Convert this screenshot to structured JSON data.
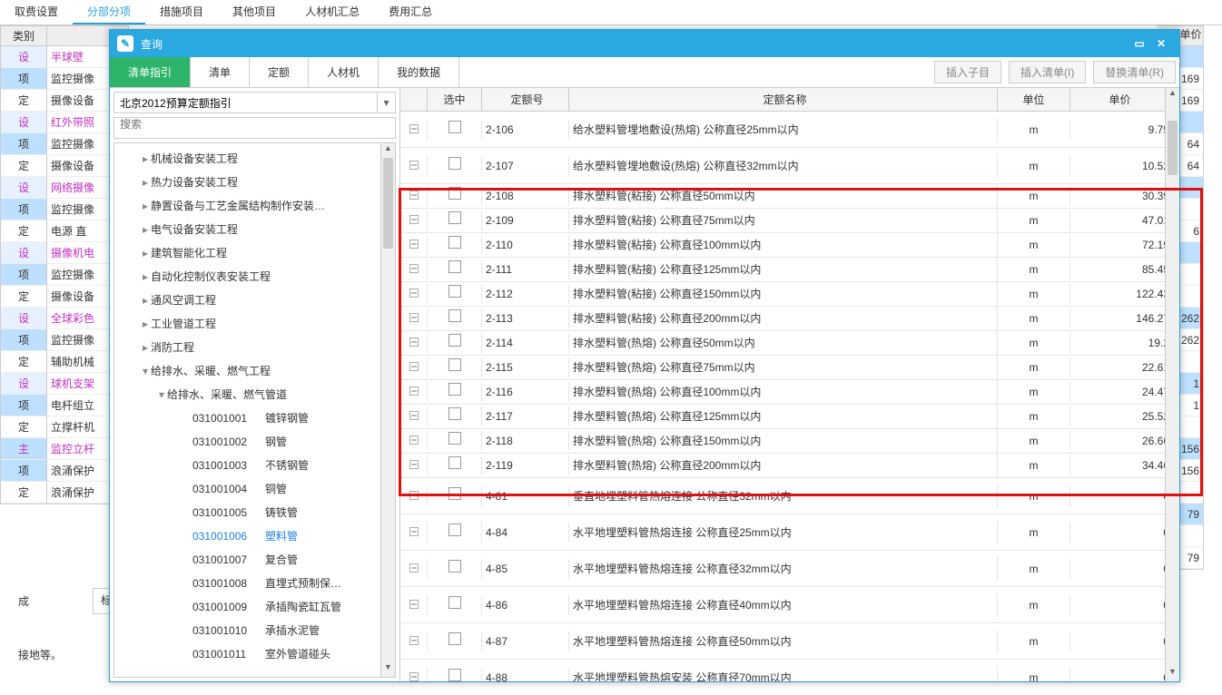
{
  "outer_tabs": [
    "取费设置",
    "分部分项",
    "措施项目",
    "其他项目",
    "人材机汇总",
    "费用汇总"
  ],
  "outer_active_index": 1,
  "left": {
    "cat_head": "类别",
    "rows": [
      {
        "k": "设",
        "name": "半球壁",
        "link": true
      },
      {
        "k": "项",
        "name": "监控摄像"
      },
      {
        "k": "定",
        "name": "摄像设备"
      },
      {
        "k": "设",
        "name": "红外带照",
        "link": true
      },
      {
        "k": "项",
        "name": "监控摄像"
      },
      {
        "k": "定",
        "name": "摄像设备"
      },
      {
        "k": "设",
        "name": "网络摄像",
        "link": true
      },
      {
        "k": "项",
        "name": "监控摄像"
      },
      {
        "k": "定",
        "name": "电源 直"
      },
      {
        "k": "设",
        "name": "摄像机电",
        "link": true
      },
      {
        "k": "项",
        "name": "监控摄像"
      },
      {
        "k": "定",
        "name": "摄像设备"
      },
      {
        "k": "设",
        "name": "全球彩色",
        "link": true
      },
      {
        "k": "项",
        "name": "监控摄像"
      },
      {
        "k": "定",
        "name": "辅助机械"
      },
      {
        "k": "设",
        "name": "球机支架",
        "link": true
      },
      {
        "k": "项",
        "name": "电杆组立"
      },
      {
        "k": "定",
        "name": "立撑杆机"
      },
      {
        "k": "主",
        "name": "监控立杆",
        "link": true
      },
      {
        "k": "项",
        "name": "浪涌保护"
      },
      {
        "k": "定",
        "name": "浪涌保护"
      }
    ]
  },
  "right_col": {
    "head": "综合单价",
    "vals": [
      "",
      "169",
      "169",
      "",
      "64",
      "64",
      "",
      "",
      "6",
      "",
      "",
      "",
      "262",
      "262",
      "",
      "1",
      "1",
      "",
      "156",
      "156",
      "",
      "79",
      "",
      "79"
    ]
  },
  "bottom": {
    "std": "标准换算",
    "empty": "成",
    "ground": "接地等。"
  },
  "dialog": {
    "title": "查询",
    "tabs": [
      "清单指引",
      "清单",
      "定额",
      "人材机",
      "我的数据"
    ],
    "active_tab": 0,
    "actions": [
      "插入子目",
      "插入清单(I)",
      "替换清单(R)"
    ],
    "dropdown": "北京2012预算定额指引",
    "search_placeholder": "搜索",
    "tree_l1": [
      {
        "lbl": "机械设备安装工程",
        "arrow": ">"
      },
      {
        "lbl": "热力设备安装工程",
        "arrow": ">"
      },
      {
        "lbl": "静置设备与工艺金属结构制作安装…",
        "arrow": ">"
      },
      {
        "lbl": "电气设备安装工程",
        "arrow": ">"
      },
      {
        "lbl": "建筑智能化工程",
        "arrow": ">"
      },
      {
        "lbl": "自动化控制仪表安装工程",
        "arrow": ">"
      },
      {
        "lbl": "通风空调工程",
        "arrow": ">"
      },
      {
        "lbl": "工业管道工程",
        "arrow": ">"
      },
      {
        "lbl": "消防工程",
        "arrow": ">"
      },
      {
        "lbl": "给排水、采暖、燃气工程",
        "arrow": "v",
        "open": true
      }
    ],
    "tree_l2": {
      "lbl": "给排水、采暖、燃气管道",
      "arrow": "v"
    },
    "tree_l3": [
      {
        "code": "031001001",
        "lbl": "镀锌钢管"
      },
      {
        "code": "031001002",
        "lbl": "钢管"
      },
      {
        "code": "031001003",
        "lbl": "不锈钢管"
      },
      {
        "code": "031001004",
        "lbl": "铜管"
      },
      {
        "code": "031001005",
        "lbl": "铸铁管"
      },
      {
        "code": "031001006",
        "lbl": "塑料管",
        "sel": true
      },
      {
        "code": "031001007",
        "lbl": "复合管"
      },
      {
        "code": "031001008",
        "lbl": "直埋式预制保…"
      },
      {
        "code": "031001009",
        "lbl": "承插陶瓷缸瓦管"
      },
      {
        "code": "031001010",
        "lbl": "承插水泥管"
      },
      {
        "code": "031001011",
        "lbl": "室外管道碰头"
      }
    ],
    "grid_head": {
      "sel": "选中",
      "code": "定额号",
      "name": "定额名称",
      "unit": "单位",
      "price": "单价"
    },
    "grid_rows": [
      {
        "code": "2-106",
        "name": "给水塑料管埋地敷设(热熔) 公称直径25mm以内",
        "unit": "m",
        "price": "9.75",
        "h2": true
      },
      {
        "code": "2-107",
        "name": "给水塑料管埋地敷设(热熔) 公称直径32mm以内",
        "unit": "m",
        "price": "10.52",
        "h2": true
      },
      {
        "code": "2-108",
        "name": "排水塑料管(粘接) 公称直径50mm以内",
        "unit": "m",
        "price": "30.39"
      },
      {
        "code": "2-109",
        "name": "排水塑料管(粘接) 公称直径75mm以内",
        "unit": "m",
        "price": "47.01"
      },
      {
        "code": "2-110",
        "name": "排水塑料管(粘接) 公称直径100mm以内",
        "unit": "m",
        "price": "72.19"
      },
      {
        "code": "2-111",
        "name": "排水塑料管(粘接) 公称直径125mm以内",
        "unit": "m",
        "price": "85.45"
      },
      {
        "code": "2-112",
        "name": "排水塑料管(粘接) 公称直径150mm以内",
        "unit": "m",
        "price": "122.43"
      },
      {
        "code": "2-113",
        "name": "排水塑料管(粘接) 公称直径200mm以内",
        "unit": "m",
        "price": "146.27"
      },
      {
        "code": "2-114",
        "name": "排水塑料管(热熔) 公称直径50mm以内",
        "unit": "m",
        "price": "19.2"
      },
      {
        "code": "2-115",
        "name": "排水塑料管(热熔) 公称直径75mm以内",
        "unit": "m",
        "price": "22.61"
      },
      {
        "code": "2-116",
        "name": "排水塑料管(热熔) 公称直径100mm以内",
        "unit": "m",
        "price": "24.47"
      },
      {
        "code": "2-117",
        "name": "排水塑料管(热熔) 公称直径125mm以内",
        "unit": "m",
        "price": "25.52"
      },
      {
        "code": "2-118",
        "name": "排水塑料管(热熔) 公称直径150mm以内",
        "unit": "m",
        "price": "26.66"
      },
      {
        "code": "2-119",
        "name": "排水塑料管(热熔) 公称直径200mm以内",
        "unit": "m",
        "price": "34.46"
      },
      {
        "code": "4-81",
        "name": "垂直地埋塑料管热熔连接 公称直径32mm以内",
        "unit": "m",
        "price": "0",
        "h2": true
      },
      {
        "code": "4-84",
        "name": "水平地埋塑料管热熔连接 公称直径25mm以内",
        "unit": "m",
        "price": "0",
        "h2": true
      },
      {
        "code": "4-85",
        "name": "水平地埋塑料管热熔连接 公称直径32mm以内",
        "unit": "m",
        "price": "0",
        "h2": true
      },
      {
        "code": "4-86",
        "name": "水平地埋塑料管热熔连接 公称直径40mm以内",
        "unit": "m",
        "price": "0",
        "h2": true
      },
      {
        "code": "4-87",
        "name": "水平地埋塑料管热熔连接 公称直径50mm以内",
        "unit": "m",
        "price": "0",
        "h2": true
      },
      {
        "code": "4-88",
        "name": "水平地埋塑料管热熔安装 公称直径70mm以内",
        "unit": "m",
        "price": "0",
        "h2": true
      }
    ]
  }
}
